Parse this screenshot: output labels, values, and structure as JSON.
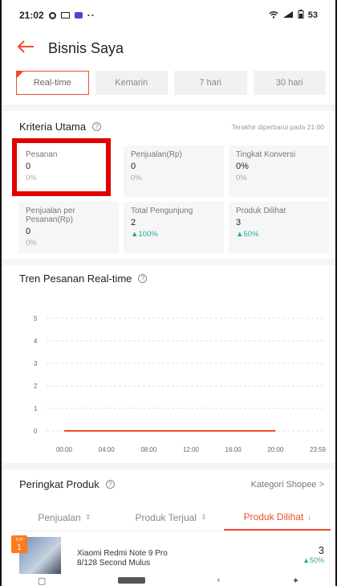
{
  "status_bar": {
    "time": "21:02",
    "dots": "··",
    "right": "53"
  },
  "header": {
    "title": "Bisnis Saya"
  },
  "range_tabs": [
    "Real-time",
    "Kemarin",
    "7 hari",
    "30 hari"
  ],
  "criteria": {
    "title": "Kriteria Utama",
    "updated": "Terakhir diperbarui pada 21:00"
  },
  "metrics": [
    {
      "label": "Pesanan",
      "value": "0",
      "pct": "0%",
      "up": false
    },
    {
      "label": "Penjualan(Rp)",
      "value": "0",
      "pct": "0%",
      "up": false
    },
    {
      "label": "Tingkat Konversi",
      "value": "0%",
      "pct": "0%",
      "up": false
    },
    {
      "label": "Penjualan per Pesanan(Rp)",
      "value": "0",
      "pct": "0%",
      "up": false
    },
    {
      "label": "Total Pengunjung",
      "value": "2",
      "pct": "▲100%",
      "up": true
    },
    {
      "label": "Produk Dilihat",
      "value": "3",
      "pct": "▲50%",
      "up": true
    }
  ],
  "trend": {
    "title": "Tren Pesanan Real-time"
  },
  "chart_data": {
    "type": "line",
    "title": "",
    "x": [
      "00:00",
      "04:00",
      "08:00",
      "12:00",
      "16:00",
      "20:00",
      "23:59"
    ],
    "series": [
      {
        "values": [
          0,
          0,
          0,
          0,
          0,
          0
        ]
      }
    ],
    "yticks": [
      0,
      1,
      2,
      3,
      4,
      5
    ],
    "ylim": [
      0,
      5
    ],
    "grid": true,
    "line_color": "#ee4d2d"
  },
  "ranking": {
    "title": "Peringkat Produk",
    "link": "Kategori Shopee >",
    "tabs": [
      {
        "label": "Penjualan",
        "icon": "⇕"
      },
      {
        "label": "Produk Terjual",
        "icon": "⇕"
      },
      {
        "label": "Produk Dilihat",
        "icon": "↓"
      }
    ],
    "products": [
      {
        "rank_label": "TOP",
        "rank": "1",
        "name_line1": "Xiaomi Redmi Note 9 Pro",
        "name_line2": "8/128 Second Mulus",
        "value": "3",
        "pct": "▲50%"
      }
    ]
  },
  "colors": {
    "accent": "#ee4d2d",
    "positive": "#26aa99",
    "highlight": "#e00000"
  }
}
